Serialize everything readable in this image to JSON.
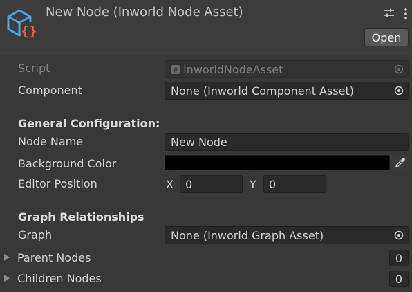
{
  "header": {
    "title": "New Node (Inworld Node Asset)",
    "open_label": "Open",
    "icon": "scriptable-object-icon",
    "icon_color_cube": "#4fa3d9",
    "icon_color_braces": "#e8603c"
  },
  "fields": {
    "script": {
      "label": "Script",
      "value": "InworldNodeAsset"
    },
    "component": {
      "label": "Component",
      "value": "None (Inworld Component Asset)"
    }
  },
  "general": {
    "title": "General Configuration:",
    "node_name": {
      "label": "Node Name",
      "value": "New Node"
    },
    "background_color": {
      "label": "Background Color",
      "value": "#000000"
    },
    "editor_position": {
      "label": "Editor Position",
      "x_label": "X",
      "x_value": "0",
      "y_label": "Y",
      "y_value": "0"
    }
  },
  "graph": {
    "title": "Graph Relationships",
    "graph_field": {
      "label": "Graph",
      "value": "None (Inworld Graph Asset)"
    },
    "parent_nodes": {
      "label": "Parent Nodes",
      "count": "0"
    },
    "children_nodes": {
      "label": "Children Nodes",
      "count": "0"
    }
  }
}
